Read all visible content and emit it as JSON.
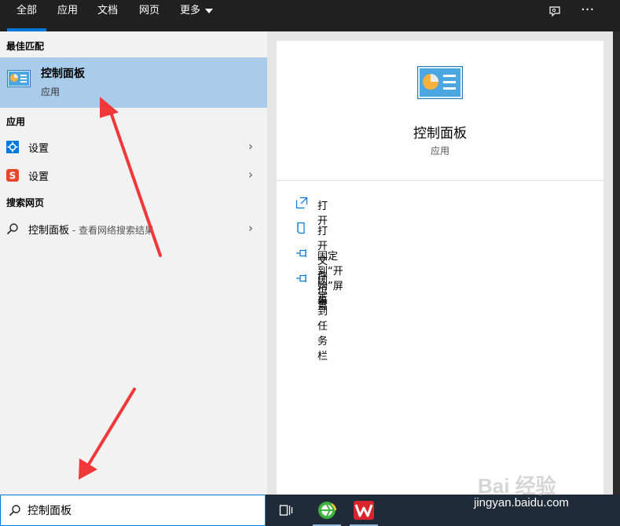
{
  "tabs": [
    {
      "label": "全部",
      "active": true
    },
    {
      "label": "应用"
    },
    {
      "label": "文档"
    },
    {
      "label": "网页"
    },
    {
      "label": "更多"
    }
  ],
  "top_icons": [
    "feedback-icon",
    "more-options-icon"
  ],
  "left": {
    "best_match_header": "最佳匹配",
    "best_match": {
      "title": "控制面板",
      "subtitle": "应用",
      "icon": "control-panel-icon"
    },
    "apps_header": "应用",
    "apps": [
      {
        "label": "设置",
        "icon": "settings-gear-icon",
        "icon_color": "#0078d7"
      },
      {
        "label": "设置",
        "icon": "sogou-s-icon",
        "icon_color": "#e8452c"
      }
    ],
    "web_header": "搜索网页",
    "web_result": {
      "query": "控制面板",
      "hint": " - 查看网络搜索结果",
      "icon": "search-icon"
    }
  },
  "preview": {
    "title": "控制面板",
    "kind": "应用",
    "actions": [
      {
        "label": "打开",
        "icon": "open-icon"
      },
      {
        "label": "打开文件位置",
        "icon": "file-location-icon"
      },
      {
        "label": "固定到“开始”屏幕",
        "icon": "pin-icon"
      },
      {
        "label": "固定到任务栏",
        "icon": "pin-icon"
      }
    ]
  },
  "search": {
    "value": "控制面板"
  },
  "taskbar": {
    "items": [
      "task-view-icon",
      "browser-icon",
      "wps-icon"
    ]
  },
  "watermark": {
    "text": "jingyan.baidu.com",
    "logo": "Bai 经验"
  },
  "colors": {
    "accent": "#0078d7",
    "selection": "#a8ccea",
    "topbar": "#202020",
    "taskbar": "#1f2b38",
    "annotation_arrow": "#f0373a"
  }
}
